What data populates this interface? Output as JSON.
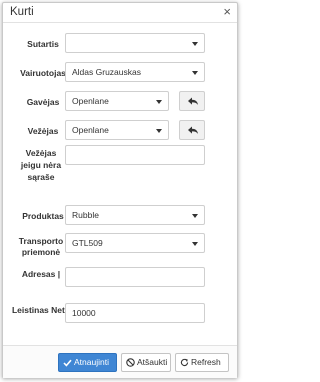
{
  "dialog": {
    "title": "Kurti",
    "close_symbol": "×"
  },
  "fields": {
    "sutartis": {
      "label": "Sutartis",
      "value": ""
    },
    "vairuotojas": {
      "label": "Vairuotojas",
      "value": "Aldas Gruzauskas"
    },
    "gavejas": {
      "label": "Gavėjas",
      "value": "Openlane"
    },
    "vezejas": {
      "label": "Vežėjas",
      "value": "Openlane"
    },
    "vezejas_not_listed": {
      "label": "Vežėjas jeigu nėra sąraše",
      "value": ""
    },
    "produktas": {
      "label": "Produktas",
      "value": "Rubble"
    },
    "transporto_priemone": {
      "label": "Transporto priemonė",
      "value": "GTL509"
    },
    "adresas": {
      "label": "Adresas |",
      "value": ""
    },
    "leistinas_neto": {
      "label": "Leistinas Neto",
      "value": "10000"
    }
  },
  "footer": {
    "update_label": "Atnaujinti",
    "cancel_label": "Atšaukti",
    "refresh_label": "Refresh"
  },
  "icons": {
    "close": "close-icon",
    "back": "reply-arrow-icon",
    "caret": "caret-down-icon",
    "check": "check-icon",
    "ban": "ban-icon",
    "refresh": "refresh-icon"
  },
  "colors": {
    "primary": "#3f86d4"
  }
}
